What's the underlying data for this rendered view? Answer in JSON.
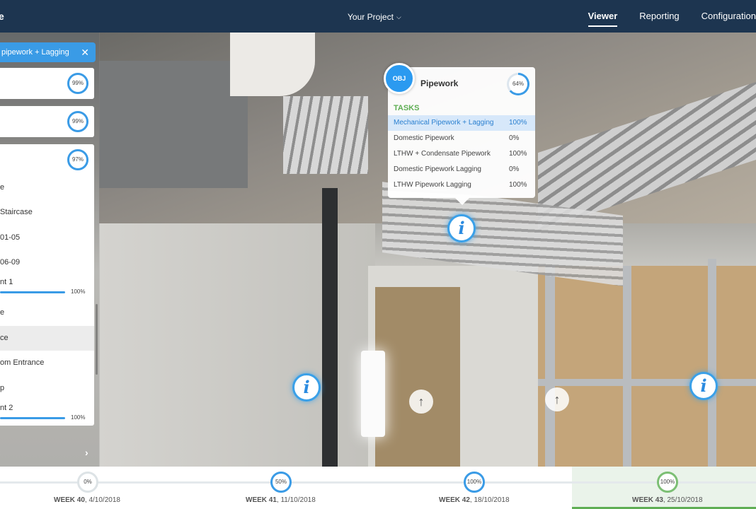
{
  "header": {
    "brand": "e",
    "project_label": "Your Project",
    "nav": [
      "Viewer",
      "Reporting",
      "Configuration"
    ]
  },
  "sidebar": {
    "filter": "pipework + Lagging",
    "cards": [
      {
        "pct": "99%"
      },
      {
        "pct": "99%"
      },
      {
        "pct": "97%"
      }
    ],
    "items": [
      "e",
      "Staircase",
      "01-05",
      "06-09",
      "nt 1",
      "e",
      "ce",
      "om Entrance",
      "p",
      "nt 2"
    ],
    "progress_labels": [
      "100%",
      "100%"
    ]
  },
  "popup": {
    "badge": "OBJ",
    "title": "Pipework",
    "pct": "64%",
    "tasks_label": "TASKS",
    "tasks": [
      {
        "name": "Mechanical Pipework + Lagging",
        "pct": "100%"
      },
      {
        "name": "Domestic Pipework",
        "pct": "0%"
      },
      {
        "name": "LTHW + Condensate Pipework",
        "pct": "100%"
      },
      {
        "name": "Domestic Pipework Lagging",
        "pct": "0%"
      },
      {
        "name": "LTHW Pipework Lagging",
        "pct": "100%"
      }
    ]
  },
  "hotspots": {
    "info_glyph": "i",
    "arrow_glyph": "↑"
  },
  "timeline": {
    "weeks": [
      {
        "week": "WEEK 40",
        "date": ", 4/10/2018",
        "pct": "0%"
      },
      {
        "week": "WEEK 41",
        "date": ", 11/10/2018",
        "pct": "50%"
      },
      {
        "week": "WEEK 42",
        "date": ", 18/10/2018",
        "pct": "100%"
      },
      {
        "week": "WEEK 43",
        "date": ", 25/10/2018",
        "pct": "100%"
      }
    ]
  },
  "colors": {
    "accent": "#3a9be6",
    "header_bg": "#1d3550",
    "green": "#5fae54"
  }
}
